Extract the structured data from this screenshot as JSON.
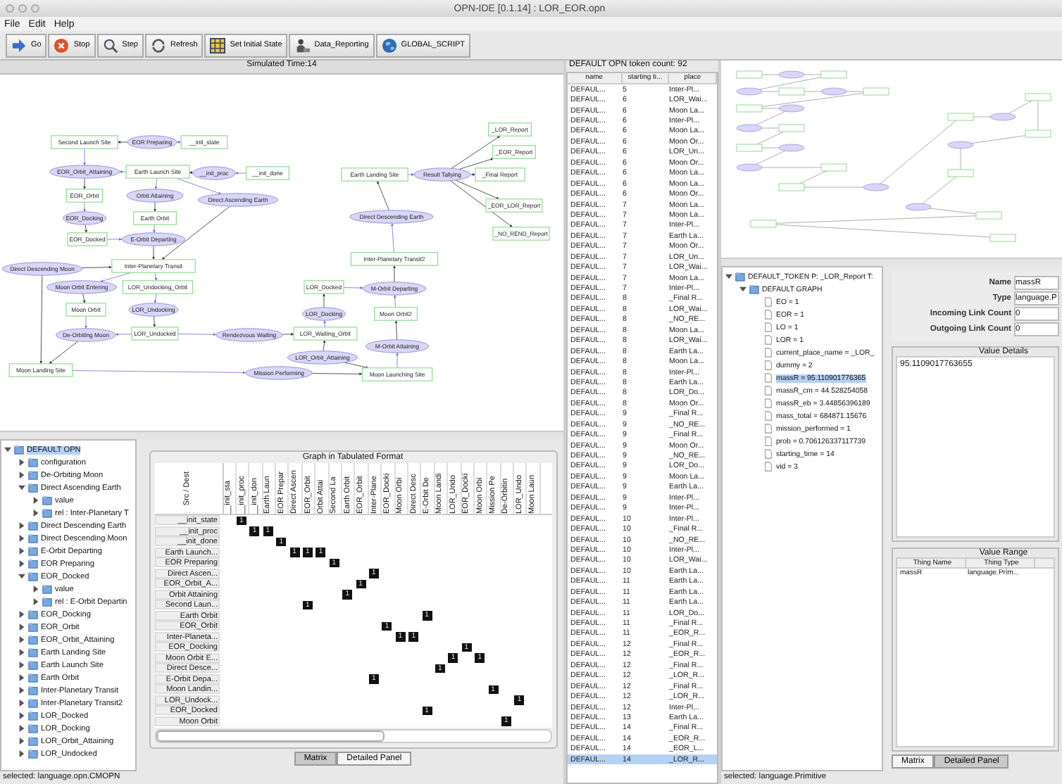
{
  "window": {
    "title": "OPN-IDE [0.1.14] : LOR_EOR.opn"
  },
  "menu": [
    "File",
    "Edit",
    "Help"
  ],
  "toolbar": [
    {
      "label": "Go"
    },
    {
      "label": "Stop"
    },
    {
      "label": "Step"
    },
    {
      "label": "Refresh"
    },
    {
      "label": "Set Initial State"
    },
    {
      "label": "Data_Reporting"
    },
    {
      "label": "GLOBAL_SCRIPT"
    }
  ],
  "graph": {
    "title": "Simulated Time:14",
    "nodes": [
      {
        "label": "Second Launch Site",
        "kind": "place"
      },
      {
        "label": "EOR Preparing",
        "kind": "transition"
      },
      {
        "label": "__init_state",
        "kind": "place"
      },
      {
        "label": "EOR_Orbit_Attaining",
        "kind": "transition"
      },
      {
        "label": "Earth Launch Site",
        "kind": "place"
      },
      {
        "label": "__init_proc",
        "kind": "transition"
      },
      {
        "label": "__init_done",
        "kind": "place"
      },
      {
        "label": "EOR_Orbit",
        "kind": "place"
      },
      {
        "label": "Orbit Attaining",
        "kind": "transition"
      },
      {
        "label": "Direct Ascending Earth",
        "kind": "transition"
      },
      {
        "label": "EOR_Docking",
        "kind": "transition"
      },
      {
        "label": "Earth Orbit",
        "kind": "place"
      },
      {
        "label": "_LOR_Report",
        "kind": "place"
      },
      {
        "label": "_EOR_Report",
        "kind": "place"
      },
      {
        "label": "Earth Landing Site",
        "kind": "place"
      },
      {
        "label": "Result Tallying",
        "kind": "transition"
      },
      {
        "label": "_Final Report",
        "kind": "place"
      },
      {
        "label": "_EOR_LOR_Report",
        "kind": "place"
      },
      {
        "label": "Direct Descending Earth",
        "kind": "transition"
      },
      {
        "label": "_NO_REND_Report",
        "kind": "place"
      },
      {
        "label": "EOR_Docked",
        "kind": "place"
      },
      {
        "label": "E-Orbit Departing",
        "kind": "transition"
      },
      {
        "label": "Inter-Planetary Transit",
        "kind": "place"
      },
      {
        "label": "Direct Descending Moon",
        "kind": "transition"
      },
      {
        "label": "Inter-Planetary Transit2",
        "kind": "place"
      },
      {
        "label": "Moon Orbit Entering",
        "kind": "transition"
      },
      {
        "label": "LOR_Undocking_Orbit",
        "kind": "place"
      },
      {
        "label": "LOR_Docked",
        "kind": "place"
      },
      {
        "label": "M-Orbit Departing",
        "kind": "transition"
      },
      {
        "label": "Moon Orbit",
        "kind": "place"
      },
      {
        "label": "LOR_Undocking",
        "kind": "transition"
      },
      {
        "label": "LOR_Docking",
        "kind": "transition"
      },
      {
        "label": "Moon Orbit2",
        "kind": "place"
      },
      {
        "label": "De-Orbiting Moon",
        "kind": "transition"
      },
      {
        "label": "LOR_Undocked",
        "kind": "place"
      },
      {
        "label": "Rendezvous Waiting",
        "kind": "transition"
      },
      {
        "label": "LOR_Waiting_Orbit",
        "kind": "place"
      },
      {
        "label": "M-Orbit Attaining",
        "kind": "transition"
      },
      {
        "label": "LOR_Orbit_Attaining",
        "kind": "transition"
      },
      {
        "label": "Moon Landing Site",
        "kind": "place"
      },
      {
        "label": "Mission Performing",
        "kind": "transition"
      },
      {
        "label": "Moon Launching Site",
        "kind": "place"
      }
    ]
  },
  "model_tree": [
    {
      "label": "DEFAULT OPN",
      "selected": true,
      "expanded": true,
      "children": [
        {
          "label": "configuration",
          "selected": false,
          "expanded": false
        },
        {
          "label": "De-Orbiting Moon",
          "selected": false,
          "expanded": false
        },
        {
          "label": "Direct Ascending Earth",
          "selected": false,
          "expanded": true,
          "children": [
            {
              "label": "value",
              "selected": false,
              "expanded": false
            },
            {
              "label": "rel : Inter-Planetary T",
              "selected": false,
              "expanded": false
            }
          ]
        },
        {
          "label": "Direct Descending Earth",
          "selected": false,
          "expanded": false
        },
        {
          "label": "Direct Descending Moon",
          "selected": false,
          "expanded": false
        },
        {
          "label": "E-Orbit Departing",
          "selected": false,
          "expanded": false
        },
        {
          "label": "EOR Preparing",
          "selected": false,
          "expanded": false
        },
        {
          "label": "EOR_Docked",
          "selected": false,
          "expanded": true,
          "children": [
            {
              "label": "value",
              "selected": false,
              "expanded": false
            },
            {
              "label": "rel : E-Orbit Departin",
              "selected": false,
              "expanded": false
            }
          ]
        },
        {
          "label": "EOR_Docking",
          "selected": false,
          "expanded": false
        },
        {
          "label": "EOR_Orbit",
          "selected": false,
          "expanded": false
        },
        {
          "label": "EOR_Orbit_Attaining",
          "selected": false,
          "expanded": false
        },
        {
          "label": "Earth Landing Site",
          "selected": false,
          "expanded": false
        },
        {
          "label": "Earth Launch Site",
          "selected": false,
          "expanded": false
        },
        {
          "label": "Earth Orbit",
          "selected": false,
          "expanded": false
        },
        {
          "label": "Inter-Planetary Transit",
          "selected": false,
          "expanded": false
        },
        {
          "label": "Inter-Planetary Transit2",
          "selected": false,
          "expanded": false
        },
        {
          "label": "LOR_Docked",
          "selected": false,
          "expanded": false
        },
        {
          "label": "LOR_Docking",
          "selected": false,
          "expanded": false
        },
        {
          "label": "LOR_Orbit_Attaining",
          "selected": false,
          "expanded": false
        },
        {
          "label": "LOR_Undocked",
          "selected": false,
          "expanded": false
        }
      ]
    }
  ],
  "left_status": "selected: language.opn.CMOPN",
  "matrix": {
    "title": "Graph in Tabulated Format",
    "corner": "Src / Dest",
    "columns": [
      "__init_sta",
      "__init_proc",
      "__init_don",
      "Earth Laun",
      "EOR Prepar",
      "Direct Ascen",
      "EOR_Orbit",
      "Orbit Attai",
      "Second La",
      "Earth Orbit",
      "EOR_Orbit",
      "Inter-Plane",
      "EOR_Docki",
      "Moon Orbi",
      "Direct Desc",
      "E-Orbit De",
      "Moon Landi",
      "LOR_Undo",
      "EOR_Docki",
      "Moon Orbi",
      "Mission Pe",
      "De-Orbitin",
      "LOR_Undo",
      "Moon Laun"
    ],
    "rows": [
      {
        "label": "__init_state",
        "cells": [
          "",
          "1"
        ]
      },
      {
        "label": "__init_proc",
        "cells": [
          "",
          "",
          "1",
          "1"
        ]
      },
      {
        "label": "__init_done",
        "cells": [
          "",
          "",
          "",
          "",
          "1"
        ]
      },
      {
        "label": "Earth Launch...",
        "cells": [
          "",
          "",
          "",
          "",
          "",
          "1",
          "1",
          "1"
        ]
      },
      {
        "label": "EOR Preparing",
        "cells": [
          "",
          "",
          "",
          "",
          "",
          "",
          "",
          "",
          "1"
        ]
      },
      {
        "label": "Direct Ascen...",
        "cells": [
          "",
          "",
          "",
          "",
          "",
          "",
          "",
          "",
          "",
          "",
          "",
          "1"
        ]
      },
      {
        "label": "EOR_Orbit_A...",
        "cells": [
          "",
          "",
          "",
          "",
          "",
          "",
          "",
          "",
          "",
          "",
          "1"
        ]
      },
      {
        "label": "Orbit Attaining",
        "cells": [
          "",
          "",
          "",
          "",
          "",
          "",
          "",
          "",
          "",
          "1"
        ]
      },
      {
        "label": "Second Laun...",
        "cells": [
          "",
          "",
          "",
          "",
          "",
          "",
          "1"
        ]
      },
      {
        "label": "Earth Orbit",
        "cells": [
          "",
          "",
          "",
          "",
          "",
          "",
          "",
          "",
          "",
          "",
          "",
          "",
          "",
          "",
          "",
          "1"
        ]
      },
      {
        "label": "EOR_Orbit",
        "cells": [
          "",
          "",
          "",
          "",
          "",
          "",
          "",
          "",
          "",
          "",
          "",
          "",
          "1"
        ]
      },
      {
        "label": "Inter-Planeta...",
        "cells": [
          "",
          "",
          "",
          "",
          "",
          "",
          "",
          "",
          "",
          "",
          "",
          "",
          "",
          "1",
          "1"
        ]
      },
      {
        "label": "EOR_Docking",
        "cells": [
          "",
          "",
          "",
          "",
          "",
          "",
          "",
          "",
          "",
          "",
          "",
          "",
          "",
          "",
          "",
          "",
          "",
          "",
          "1"
        ]
      },
      {
        "label": "Moon Orbit E...",
        "cells": [
          "",
          "",
          "",
          "",
          "",
          "",
          "",
          "",
          "",
          "",
          "",
          "",
          "",
          "",
          "",
          "",
          "",
          "1",
          "",
          "1"
        ]
      },
      {
        "label": "Direct Desce...",
        "cells": [
          "",
          "",
          "",
          "",
          "",
          "",
          "",
          "",
          "",
          "",
          "",
          "",
          "",
          "",
          "",
          "",
          "1"
        ]
      },
      {
        "label": "E-Orbit Depa...",
        "cells": [
          "",
          "",
          "",
          "",
          "",
          "",
          "",
          "",
          "",
          "",
          "",
          "1"
        ]
      },
      {
        "label": "Moon Landin...",
        "cells": [
          "",
          "",
          "",
          "",
          "",
          "",
          "",
          "",
          "",
          "",
          "",
          "",
          "",
          "",
          "",
          "",
          "",
          "",
          "",
          "",
          "1"
        ]
      },
      {
        "label": "LOR_Undock...",
        "cells": [
          "",
          "",
          "",
          "",
          "",
          "",
          "",
          "",
          "",
          "",
          "",
          "",
          "",
          "",
          "",
          "",
          "",
          "",
          "",
          "",
          "",
          "",
          "1"
        ]
      },
      {
        "label": "EOR_Docked",
        "cells": [
          "",
          "",
          "",
          "",
          "",
          "",
          "",
          "",
          "",
          "",
          "",
          "",
          "",
          "",
          "",
          "1"
        ]
      },
      {
        "label": "Moon Orbit",
        "cells": [
          "",
          "",
          "",
          "",
          "",
          "",
          "",
          "",
          "",
          "",
          "",
          "",
          "",
          "",
          "",
          "",
          "",
          "",
          "",
          "",
          "",
          "1"
        ]
      }
    ],
    "tabs": [
      {
        "label": "Matrix",
        "selected": true
      },
      {
        "label": "Detailed Panel",
        "selected": false
      }
    ]
  },
  "tokens": {
    "title": "DEFAULT OPN token count: 92",
    "columns": [
      "name",
      "starting ti...",
      "place"
    ],
    "rows": [
      {
        "name": "DEFAUL...",
        "time": "5",
        "place": "Inter-Pl...",
        "selected": false
      },
      {
        "name": "DEFAUL...",
        "time": "6",
        "place": "LOR_Wai...",
        "selected": false
      },
      {
        "name": "DEFAUL...",
        "time": "6",
        "place": "Moon La...",
        "selected": false
      },
      {
        "name": "DEFAUL...",
        "time": "6",
        "place": "Inter-Pl...",
        "selected": false
      },
      {
        "name": "DEFAUL...",
        "time": "6",
        "place": "Moon La...",
        "selected": false
      },
      {
        "name": "DEFAUL...",
        "time": "6",
        "place": "Moon Or...",
        "selected": false
      },
      {
        "name": "DEFAUL...",
        "time": "6",
        "place": "LOR_Un...",
        "selected": false
      },
      {
        "name": "DEFAUL...",
        "time": "6",
        "place": "Moon Or...",
        "selected": false
      },
      {
        "name": "DEFAUL...",
        "time": "6",
        "place": "Moon La...",
        "selected": false
      },
      {
        "name": "DEFAUL...",
        "time": "6",
        "place": "Moon La...",
        "selected": false
      },
      {
        "name": "DEFAUL...",
        "time": "6",
        "place": "Moon Or...",
        "selected": false
      },
      {
        "name": "DEFAUL...",
        "time": "7",
        "place": "Moon La...",
        "selected": false
      },
      {
        "name": "DEFAUL...",
        "time": "7",
        "place": "Moon La...",
        "selected": false
      },
      {
        "name": "DEFAUL...",
        "time": "7",
        "place": "Inter-Pl...",
        "selected": false
      },
      {
        "name": "DEFAUL...",
        "time": "7",
        "place": "Earth La...",
        "selected": false
      },
      {
        "name": "DEFAUL...",
        "time": "7",
        "place": "Moon Or...",
        "selected": false
      },
      {
        "name": "DEFAUL...",
        "time": "7",
        "place": "LOR_Un...",
        "selected": false
      },
      {
        "name": "DEFAUL...",
        "time": "7",
        "place": "LOR_Wai...",
        "selected": false
      },
      {
        "name": "DEFAUL...",
        "time": "7",
        "place": "Moon La...",
        "selected": false
      },
      {
        "name": "DEFAUL...",
        "time": "7",
        "place": "Inter-Pl...",
        "selected": false
      },
      {
        "name": "DEFAUL...",
        "time": "8",
        "place": "_Final R...",
        "selected": false
      },
      {
        "name": "DEFAUL...",
        "time": "8",
        "place": "LOR_Wai...",
        "selected": false
      },
      {
        "name": "DEFAUL...",
        "time": "8",
        "place": "_NO_RE...",
        "selected": false
      },
      {
        "name": "DEFAUL...",
        "time": "8",
        "place": "Moon La...",
        "selected": false
      },
      {
        "name": "DEFAUL...",
        "time": "8",
        "place": "LOR_Wai...",
        "selected": false
      },
      {
        "name": "DEFAUL...",
        "time": "8",
        "place": "Earth La...",
        "selected": false
      },
      {
        "name": "DEFAUL...",
        "time": "8",
        "place": "Moon La...",
        "selected": false
      },
      {
        "name": "DEFAUL...",
        "time": "8",
        "place": "Inter-Pl...",
        "selected": false
      },
      {
        "name": "DEFAUL...",
        "time": "8",
        "place": "Earth La...",
        "selected": false
      },
      {
        "name": "DEFAUL...",
        "time": "8",
        "place": "LOR_Do...",
        "selected": false
      },
      {
        "name": "DEFAUL...",
        "time": "8",
        "place": "Moon Or...",
        "selected": false
      },
      {
        "name": "DEFAUL...",
        "time": "9",
        "place": "_Final R...",
        "selected": false
      },
      {
        "name": "DEFAUL...",
        "time": "9",
        "place": "_NO_RE...",
        "selected": false
      },
      {
        "name": "DEFAUL...",
        "time": "9",
        "place": "_Final R...",
        "selected": false
      },
      {
        "name": "DEFAUL...",
        "time": "9",
        "place": "Moon Or...",
        "selected": false
      },
      {
        "name": "DEFAUL...",
        "time": "9",
        "place": "_NO_RE...",
        "selected": false
      },
      {
        "name": "DEFAUL...",
        "time": "9",
        "place": "LOR_Do...",
        "selected": false
      },
      {
        "name": "DEFAUL...",
        "time": "9",
        "place": "Moon La...",
        "selected": false
      },
      {
        "name": "DEFAUL...",
        "time": "9",
        "place": "Earth La...",
        "selected": false
      },
      {
        "name": "DEFAUL...",
        "time": "9",
        "place": "Inter-Pl...",
        "selected": false
      },
      {
        "name": "DEFAUL...",
        "time": "9",
        "place": "Inter-Pl...",
        "selected": false
      },
      {
        "name": "DEFAUL...",
        "time": "10",
        "place": "Inter-Pl...",
        "selected": false
      },
      {
        "name": "DEFAUL...",
        "time": "10",
        "place": "_Final R...",
        "selected": false
      },
      {
        "name": "DEFAUL...",
        "time": "10",
        "place": "_NO_RE...",
        "selected": false
      },
      {
        "name": "DEFAUL...",
        "time": "10",
        "place": "Inter-Pl...",
        "selected": false
      },
      {
        "name": "DEFAUL...",
        "time": "10",
        "place": "LOR_Wai...",
        "selected": false
      },
      {
        "name": "DEFAUL...",
        "time": "10",
        "place": "Earth La...",
        "selected": false
      },
      {
        "name": "DEFAUL...",
        "time": "11",
        "place": "Earth La...",
        "selected": false
      },
      {
        "name": "DEFAUL...",
        "time": "11",
        "place": "Earth La...",
        "selected": false
      },
      {
        "name": "DEFAUL...",
        "time": "11",
        "place": "Earth La...",
        "selected": false
      },
      {
        "name": "DEFAUL...",
        "time": "11",
        "place": "LOR_Do...",
        "selected": false
      },
      {
        "name": "DEFAUL...",
        "time": "11",
        "place": "_Final R...",
        "selected": false
      },
      {
        "name": "DEFAUL...",
        "time": "11",
        "place": "_EOR_R...",
        "selected": false
      },
      {
        "name": "DEFAUL...",
        "time": "12",
        "place": "_Final R...",
        "selected": false
      },
      {
        "name": "DEFAUL...",
        "time": "12",
        "place": "_EOR_R...",
        "selected": false
      },
      {
        "name": "DEFAUL...",
        "time": "12",
        "place": "_Final R...",
        "selected": false
      },
      {
        "name": "DEFAUL...",
        "time": "12",
        "place": "_LOR_R...",
        "selected": false
      },
      {
        "name": "DEFAUL...",
        "time": "12",
        "place": "_Final R...",
        "selected": false
      },
      {
        "name": "DEFAUL...",
        "time": "12",
        "place": "_LOR_R...",
        "selected": false
      },
      {
        "name": "DEFAUL...",
        "time": "12",
        "place": "Inter-Pl...",
        "selected": false
      },
      {
        "name": "DEFAUL...",
        "time": "13",
        "place": "Earth La...",
        "selected": false
      },
      {
        "name": "DEFAUL...",
        "time": "14",
        "place": "_Final R...",
        "selected": false
      },
      {
        "name": "DEFAUL...",
        "time": "14",
        "place": "_EOR_R...",
        "selected": false
      },
      {
        "name": "DEFAUL...",
        "time": "14",
        "place": "_EOR_L...",
        "selected": false
      },
      {
        "name": "DEFAUL...",
        "time": "14",
        "place": "_LOR_R...",
        "selected": true
      }
    ]
  },
  "token_tree": [
    {
      "label": "DEFAULT_TOKEN P: _LOR_Report T:",
      "selected": false,
      "expanded": true,
      "children": [
        {
          "label": "DEFAULT GRAPH",
          "selected": false,
          "expanded": true,
          "children": [
            {
              "label": "EO = 1",
              "selected": false
            },
            {
              "label": "EOR = 1",
              "selected": false
            },
            {
              "label": "LO = 1",
              "selected": false
            },
            {
              "label": "LOR = 1",
              "selected": false
            },
            {
              "label": "current_place_name = _LOR_",
              "selected": false
            },
            {
              "label": "dummy = 2",
              "selected": false
            },
            {
              "label": "massR = 95.110901776365",
              "selected": true
            },
            {
              "label": "massR_cm = 44.528254058",
              "selected": false
            },
            {
              "label": "massR_eb = 3.44856396189",
              "selected": false
            },
            {
              "label": "mass_total = 684871.15676",
              "selected": false
            },
            {
              "label": "mission_performed = 1",
              "selected": false
            },
            {
              "label": "prob = 0.706126337117739",
              "selected": false
            },
            {
              "label": "starting_time = 14",
              "selected": false
            },
            {
              "label": "vid = 3",
              "selected": false
            }
          ]
        }
      ]
    }
  ],
  "right_status": "selected: language.Primitive",
  "details": {
    "fields": [
      {
        "label": "Name",
        "value": "massR"
      },
      {
        "label": "Type",
        "value": "language.P"
      },
      {
        "label": "Incoming Link Count",
        "value": "0"
      },
      {
        "label": "Outgoing Link Count",
        "value": "0"
      }
    ],
    "value_title": "Value Details",
    "value": "95.1109017763655",
    "range_title": "Value Range",
    "range_columns": [
      "Thing Name",
      "Thing Type"
    ],
    "range_rows": [
      [
        "massR",
        "language.Prim..."
      ]
    ],
    "tabs": [
      {
        "label": "Matrix",
        "selected": false
      },
      {
        "label": "Detailed Panel",
        "selected": true
      }
    ]
  }
}
